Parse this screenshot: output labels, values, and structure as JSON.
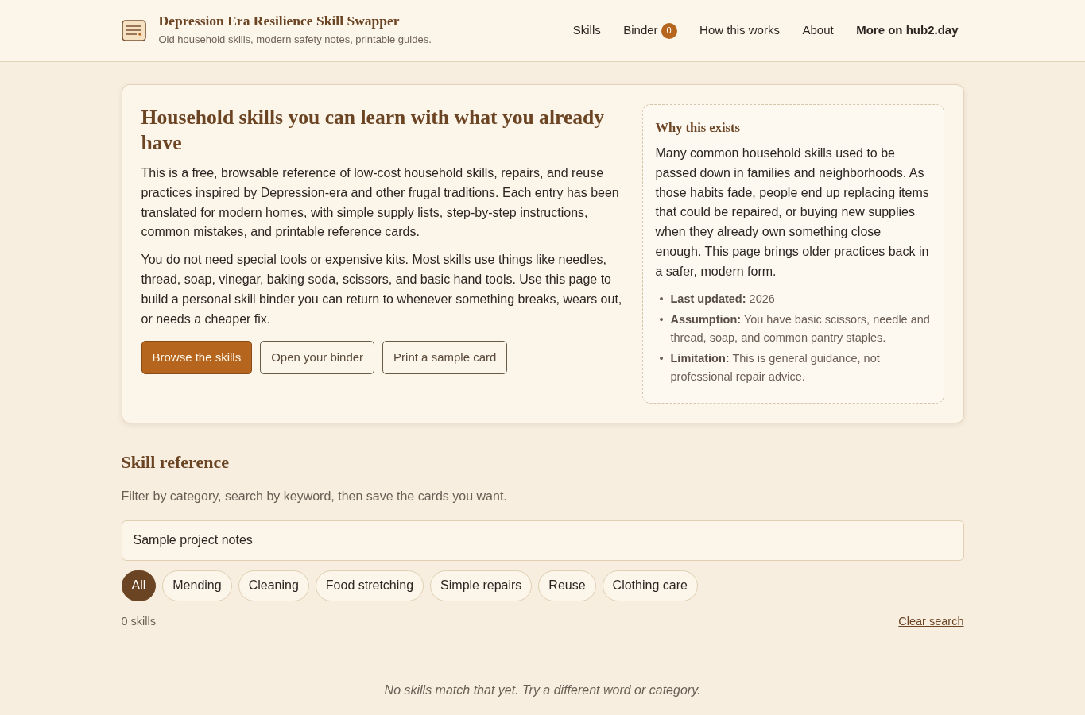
{
  "header": {
    "title": "Depression Era Resilience Skill Swapper",
    "subtitle": "Old household skills, modern safety notes, printable guides.",
    "nav": [
      {
        "label": "Skills",
        "kind": "plain"
      },
      {
        "label": "Binder",
        "kind": "plain",
        "badge": "0"
      },
      {
        "label": "How this works",
        "kind": "plain"
      },
      {
        "label": "About",
        "kind": "plain"
      },
      {
        "label": "More on hub2.day",
        "kind": "strong"
      }
    ]
  },
  "hero": {
    "heading": "Household skills you can learn with what you already have",
    "paragraphs": [
      "This is a free, browsable reference of low-cost household skills, repairs, and reuse practices inspired by Depression-era and other frugal traditions. Each entry has been translated for modern homes, with simple supply lists, step-by-step instructions, common mistakes, and printable reference cards.",
      "You do not need special tools or expensive kits. Most skills use things like needles, thread, soap, vinegar, baking soda, scissors, and basic hand tools. Use this page to build a personal skill binder you can return to whenever something breaks, wears out, or needs a cheaper fix."
    ],
    "buttons": [
      {
        "label": "Browse the skills",
        "kind": "primary"
      },
      {
        "label": "Open your binder",
        "kind": "outline"
      },
      {
        "label": "Print a sample card",
        "kind": "outline"
      }
    ],
    "aside": {
      "heading": "Why this exists",
      "paragraph": "Many common household skills used to be passed down in families and neighborhoods. As those habits fade, people end up replacing items that could be repaired, or buying new supplies when they already own something close enough. This page brings older practices back in a safer, modern form.",
      "facts": [
        {
          "marker": "•",
          "text": "**Last updated:** 2026"
        },
        {
          "marker": "•",
          "text": "**Assumption:** You have basic scissors, needle and thread, soap, and common pantry staples."
        },
        {
          "marker": "•",
          "text": "**Limitation:** This is general guidance, not professional repair advice."
        }
      ]
    }
  },
  "reference": {
    "heading": "Skill reference",
    "intro": "Filter by category, search by keyword, then save the cards you want.",
    "search": {
      "value": "Sample project notes"
    },
    "filters": [
      {
        "label": "All",
        "selected": true
      },
      {
        "label": "Mending",
        "selected": false
      },
      {
        "label": "Cleaning",
        "selected": false
      },
      {
        "label": "Food stretching",
        "selected": false
      },
      {
        "label": "Simple repairs",
        "selected": false
      },
      {
        "label": "Reuse",
        "selected": false
      },
      {
        "label": "Clothing care",
        "selected": false
      }
    ],
    "count": "0 skills",
    "clear_link": "Clear search",
    "empty_message": "No skills match that yet. Try a different word or category."
  }
}
